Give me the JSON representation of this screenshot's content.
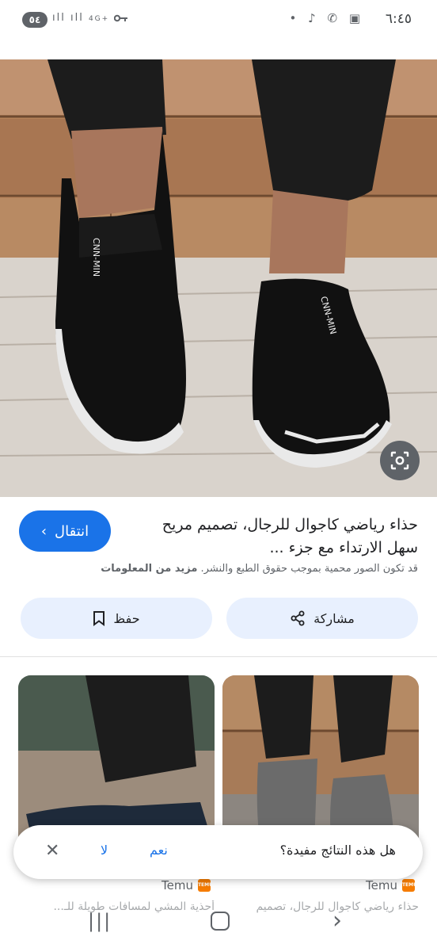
{
  "status_bar": {
    "time": "٦:٤٥",
    "battery": "٥٤",
    "network": "4G+",
    "left_icons": "ıll ıll",
    "right_icons_label": "•",
    "icons": [
      "battery-icon",
      "signal-icon",
      "key-icon",
      "tiktok-icon",
      "whatsapp-icon",
      "screenshot-icon"
    ]
  },
  "product": {
    "title": "حذاء رياضي كاجوال للرجال، تصميم مريح سهل الارتداء مع جزء ...",
    "visit_label": "انتقال",
    "copyright_text": "قد تكون الصور محمية بموجب حقوق الطبع والنشر.",
    "more_info_label": "مزيد من المعلومات",
    "share_label": "مشاركة",
    "save_label": "حفظ"
  },
  "related": [
    {
      "source": "Temu",
      "caption": "حذاء رياضي كاجوال للرجال، تصميم"
    },
    {
      "source": "Temu",
      "caption": "أحذية المشي لمسافات طويلة للـ..."
    }
  ],
  "feedback": {
    "question": "هل هذه النتائج مفيدة؟",
    "yes_label": "نعم",
    "no_label": "لا",
    "close_symbol": "✕"
  },
  "nav_bar": {
    "recents_symbol": "|||",
    "back_symbol": "›"
  },
  "colors": {
    "accent": "#1a73e8",
    "pill_bg": "#e8f0fe",
    "temu_orange": "#f57c00"
  }
}
